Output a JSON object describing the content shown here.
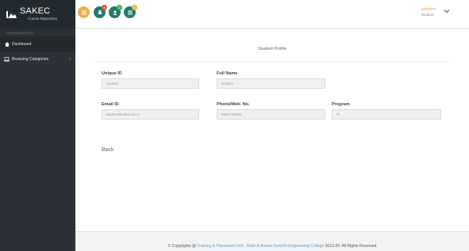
{
  "brand": {
    "title": "SAKEC",
    "subtitle": "Course Repository"
  },
  "sidebar": {
    "heading": "MAIN NAVIGATION",
    "items": [
      {
        "label": "Dashboard",
        "icon": "home-icon"
      },
      {
        "label": "Browsing Categories",
        "icon": "laptop-icon",
        "chevron": "‹"
      }
    ]
  },
  "topbar": {
    "icons": [
      {
        "name": "list-icon",
        "color": "#f0ad4e"
      },
      {
        "name": "bell-icon",
        "color": "#1f7a6c",
        "badge": "4"
      },
      {
        "name": "user-icon",
        "color": "#1f7a6c",
        "badge": "2"
      },
      {
        "name": "tasks-icon",
        "color": "#1f7a6c",
        "badge": "3"
      }
    ],
    "user_name": "student",
    "user_role": "Student"
  },
  "profile": {
    "title": "Student Profile",
    "unique_id_label": "Unique ID",
    "unique_id_value": "student",
    "full_name_label": "Full Name",
    "full_name_value": "student",
    "email_label": "Email ID",
    "email_value": "student@sakec.ac.in",
    "phone_label": "Phone/Mob. No.",
    "phone_value": "9594730826",
    "program_label": "Program",
    "program_value": "IT",
    "back_label": "Back"
  },
  "footer": {
    "prefix": "© Copyrights @",
    "link": "Training & Placement Cell - Shah & Anchor Kutchhi Engineering College",
    "suffix": "2019-20. All Rights Reserved"
  },
  "colors": {
    "sidebar": "#2b3136",
    "accent": "#f0ad4e",
    "teal": "#1f7a6c",
    "link": "#5aa0d6"
  }
}
